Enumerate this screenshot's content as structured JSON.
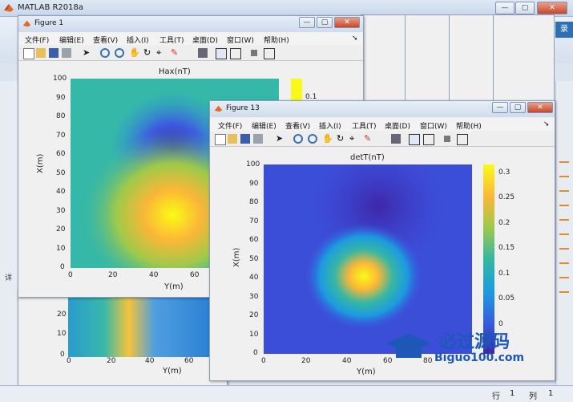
{
  "app": {
    "title": "MATLAB R2018a",
    "login_label": "录",
    "status_row_label": "行",
    "status_row_value": "1",
    "status_col_label": "列",
    "status_col_value": "1"
  },
  "menus": [
    "文件(F)",
    "编辑(E)",
    "查看(V)",
    "插入(I)",
    "工具(T)",
    "桌面(D)",
    "窗口(W)",
    "帮助(H)"
  ],
  "figure1": {
    "title": "Figure 1",
    "plot_title": "Hax(nT)",
    "xlabel": "Y(m)",
    "ylabel": "X(m)",
    "yticks": [
      "100",
      "90",
      "80",
      "70",
      "60",
      "50",
      "40",
      "30",
      "20",
      "10",
      "0"
    ],
    "xticks": [
      "0",
      "20",
      "40",
      "60"
    ],
    "colorbar_tick": "0.1"
  },
  "figure_behind": {
    "xlabel": "Y(m)",
    "yticks": [
      "20",
      "10",
      "0"
    ],
    "xticks": [
      "0",
      "20",
      "40",
      "60"
    ],
    "side_label": "详"
  },
  "figure13": {
    "title": "Figure 13",
    "plot_title": "detT(nT)",
    "xlabel": "Y(m)",
    "ylabel": "X(m)",
    "yticks": [
      "100",
      "90",
      "80",
      "70",
      "60",
      "50",
      "40",
      "30",
      "20",
      "10",
      "0"
    ],
    "xticks": [
      "0",
      "20",
      "40",
      "60",
      "80"
    ],
    "colorbar_ticks": [
      "0.3",
      "0.25",
      "0.2",
      "0.15",
      "0.1",
      "0.05",
      "0"
    ]
  },
  "watermark": {
    "brand": "必过源码",
    "url": "Biguo100.com"
  },
  "colors": {
    "parula_low": "#3e26a8",
    "parula_high": "#f9fb15",
    "accent": "#1d57b8"
  }
}
